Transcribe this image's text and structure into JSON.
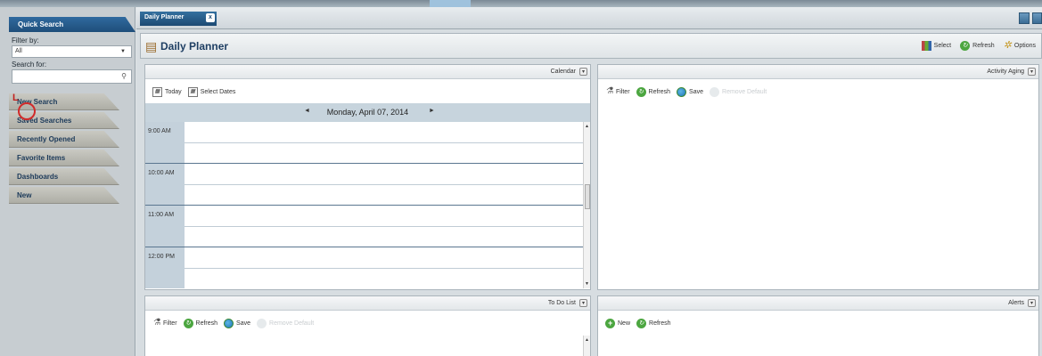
{
  "sidebar": {
    "header": "Quick Search",
    "filter_label": "Filter by:",
    "filter_value": "All",
    "search_label": "Search for:",
    "search_value": "",
    "items": [
      {
        "label": "New Search"
      },
      {
        "label": "Saved Searches"
      },
      {
        "label": "Recently Opened"
      },
      {
        "label": "Favorite Items"
      },
      {
        "label": "Dashboards"
      },
      {
        "label": "New"
      }
    ]
  },
  "tab": {
    "label": "Daily Planner",
    "close": "x"
  },
  "header": {
    "title": "Daily Planner",
    "select_label": "Select",
    "refresh_label": "Refresh",
    "options_label": "Options"
  },
  "calendar": {
    "title": "Calendar",
    "today_label": "Today",
    "select_dates_label": "Select Dates",
    "date": "Monday, April 07, 2014",
    "prev": "◄",
    "next": "►",
    "times": [
      "9:00 AM",
      "10:00 AM",
      "11:00 AM",
      "12:00 PM"
    ]
  },
  "activity": {
    "title": "Activity Aging",
    "filter_label": "Filter",
    "refresh_label": "Refresh",
    "save_label": "Save",
    "remove_label": "Remove Default"
  },
  "todo": {
    "title": "To Do List",
    "filter_label": "Filter",
    "refresh_label": "Refresh",
    "save_label": "Save",
    "remove_label": "Remove Default"
  },
  "alerts": {
    "title": "Alerts",
    "new_label": "New",
    "refresh_label": "Refresh"
  },
  "colors": {
    "accent": "#1f4e7a",
    "refresh": "#4ca640"
  }
}
